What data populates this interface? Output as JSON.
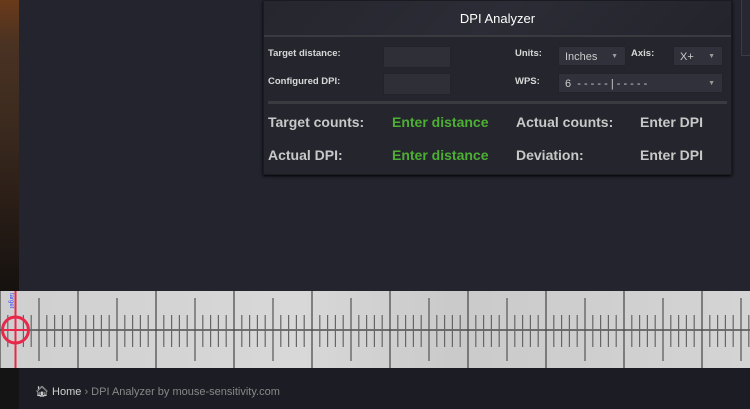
{
  "panel": {
    "title": "DPI Analyzer",
    "fields": {
      "target_distance_label": "Target distance:",
      "target_distance_value": "",
      "configured_dpi_label": "Configured DPI:",
      "configured_dpi_value": "",
      "units_label": "Units:",
      "units_value": "Inches",
      "axis_label": "Axis:",
      "axis_value": "X+",
      "wps_label": "WPS:",
      "wps_value": "6  - - - - - | - - - - -"
    },
    "results": {
      "target_counts_label": "Target counts:",
      "target_counts_value": "Enter distance",
      "actual_counts_label": "Actual counts:",
      "actual_counts_value": "Enter DPI",
      "actual_dpi_label": "Actual DPI:",
      "actual_dpi_value": "Enter distance",
      "deviation_label": "Deviation:",
      "deviation_value": "Enter DPI"
    }
  },
  "ruler": {
    "target_label": "target",
    "crosshair_color": "#e8284a",
    "target_label_color": "#3344ff"
  },
  "breadcrumb": {
    "home": "Home",
    "separator": "›",
    "current": "DPI Analyzer by mouse-sensitivity.com"
  },
  "colors": {
    "accent_green": "#4caf33",
    "background": "#23242e"
  }
}
